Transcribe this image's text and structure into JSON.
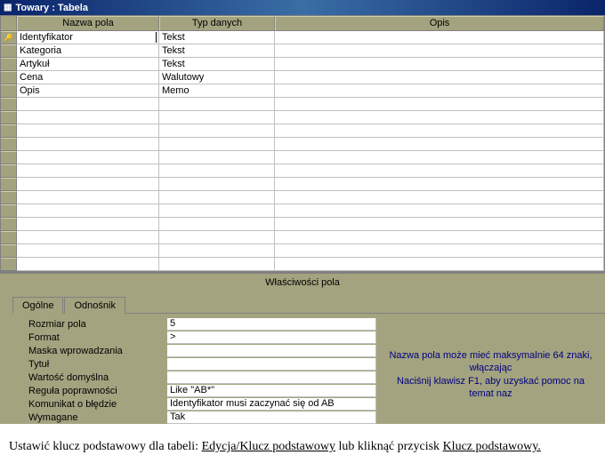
{
  "window": {
    "title": "Towary : Tabela"
  },
  "columns": {
    "name": "Nazwa pola",
    "type": "Typ danych",
    "desc": "Opis"
  },
  "fields": [
    {
      "name": "Identyfikator",
      "type": "Tekst",
      "desc": "",
      "pk": true,
      "selected": true
    },
    {
      "name": "Kategoria",
      "type": "Tekst",
      "desc": ""
    },
    {
      "name": "Artykuł",
      "type": "Tekst",
      "desc": ""
    },
    {
      "name": "Cena",
      "type": "Walutowy",
      "desc": ""
    },
    {
      "name": "Opis",
      "type": "Memo",
      "desc": ""
    }
  ],
  "propsTitle": "Właściwości pola",
  "tabs": {
    "general": "Ogólne",
    "lookup": "Odnośnik"
  },
  "props": [
    {
      "label": "Rozmiar pola",
      "value": "5"
    },
    {
      "label": "Format",
      "value": ">"
    },
    {
      "label": "Maska wprowadzania",
      "value": ""
    },
    {
      "label": "Tytuł",
      "value": ""
    },
    {
      "label": "Wartość domyślna",
      "value": ""
    },
    {
      "label": "Reguła poprawności",
      "value": "Like \"AB*\""
    },
    {
      "label": "Komunikat o błędzie",
      "value": "Identyfikator musi zaczynać się od AB"
    },
    {
      "label": "Wymagane",
      "value": "Tak"
    }
  ],
  "helpText": {
    "line1": "Nazwa pola może mieć maksymalnie 64 znaki, włączając",
    "line2": "Naciśnij klawisz F1, aby uzyskać pomoc na temat naz"
  },
  "footer": {
    "pre": "Ustawić klucz podstawowy dla tabeli: ",
    "link1": "Edycja/Klucz podstawowy",
    "mid": " lub kliknąć przycisk ",
    "link2": "Klucz podstawowy."
  }
}
